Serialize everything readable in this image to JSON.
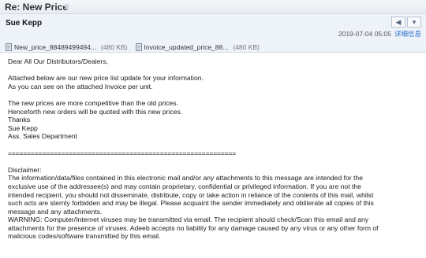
{
  "window": {
    "subject": "Re: New Price"
  },
  "header": {
    "sender": "Sue Kepp",
    "datetime": "2019-07-04 05:05",
    "details_link": "详细信息"
  },
  "attachments": [
    {
      "name": "New_price_88489499494...",
      "size": "(480 KB)"
    },
    {
      "name": "Invoice_updated_price_88...",
      "size": "(480 KB)"
    }
  ],
  "icons": {
    "star": "star-icon",
    "nav_prev": "reply-arrow-icon",
    "nav_menu": "dropdown-icon",
    "attachment": "paperclip-icon"
  },
  "body": {
    "greeting": "Dear All Our Distributors/Dealers,",
    "p1_line1": "Attached below are our new price list update for your information.",
    "p1_line2": "As you can see on the attached Invoice per unit.",
    "p2_line1": "The new prices are more competitive than the old prices.",
    "p2_line2": "Henceforth new orders will be quoted with this new prices.",
    "thanks": "Thanks",
    "sig_name": "Sue Kepp",
    "sig_title": "Ass. Sales Department",
    "separator": "============================================================",
    "disclaimer_title": "Disclaimer:",
    "disclaimer_1": "The information/data/files contained in this electronic mail and/or any attachments to this message are intended for the",
    "disclaimer_2": "exclusive use of the addressee(s) and may contain proprietary, confidential or privileged information. If you are not the",
    "disclaimer_3": "intended recipient, you should not disseminate, distribute, copy or take action in reliance of the contents of this mail, whilst",
    "disclaimer_4": "such acts are sternly forbidden and may be illegal. Please acquaint the sender immediately and obliterate all copies of this",
    "disclaimer_5": "message and any attachments.",
    "warning_1": "WARNING: Computer/Internet viruses may be transmitted via email. The recipient should check/Scan this email and any",
    "warning_2": "attachments for the presence of viruses. Adeeb accepts no liability for any damage caused by any virus or any other form of",
    "warning_3": "malicious codes/software transmitted by this email."
  }
}
